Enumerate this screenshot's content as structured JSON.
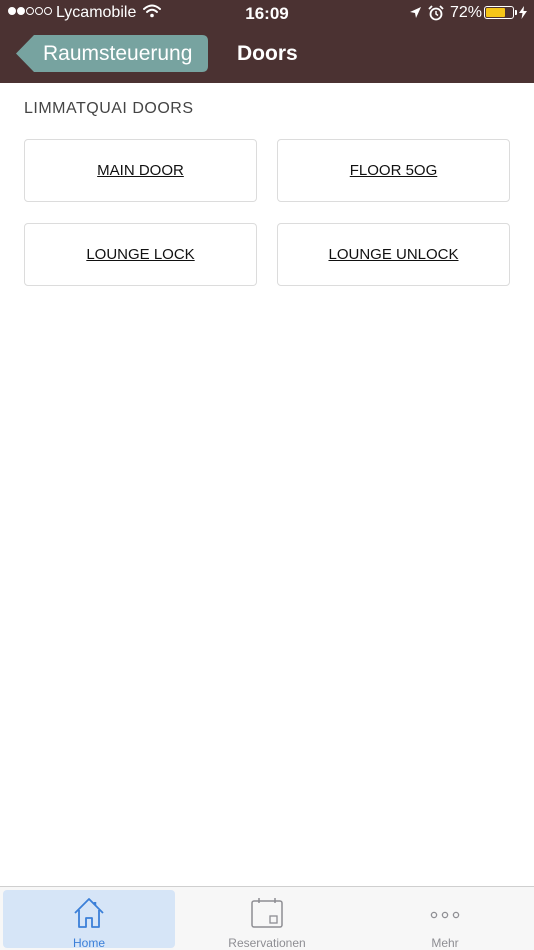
{
  "status_bar": {
    "carrier": "Lycamobile",
    "time": "16:09",
    "battery_percent": "72%",
    "battery_level": 0.72,
    "signal_bars_filled": 2,
    "signal_bars_total": 5,
    "icons": [
      "signal-dots-icon",
      "wifi-icon",
      "location-arrow-icon",
      "alarm-clock-icon",
      "battery-icon",
      "charging-bolt-icon"
    ]
  },
  "nav": {
    "back_label": "Raumsteuerung",
    "title": "Doors"
  },
  "section": {
    "title": "LIMMATQUAI DOORS"
  },
  "doors": [
    {
      "label": "MAIN DOOR"
    },
    {
      "label": "FLOOR 5OG"
    },
    {
      "label": "LOUNGE LOCK"
    },
    {
      "label": "LOUNGE UNLOCK"
    }
  ],
  "tabbar": {
    "tabs": [
      {
        "label": "Home",
        "icon": "home-icon",
        "active": true
      },
      {
        "label": "Reservationen",
        "icon": "calendar-icon",
        "active": false
      },
      {
        "label": "Mehr",
        "icon": "more-dots-icon",
        "active": false
      }
    ]
  },
  "colors": {
    "header_bg": "#4b3232",
    "back_button_bg": "#77a3a0",
    "battery_fill": "#f5c518",
    "tab_active_bg": "#d6e5f7",
    "tab_active_text": "#3b7fd8",
    "tab_inactive_text": "#8e8e93"
  }
}
